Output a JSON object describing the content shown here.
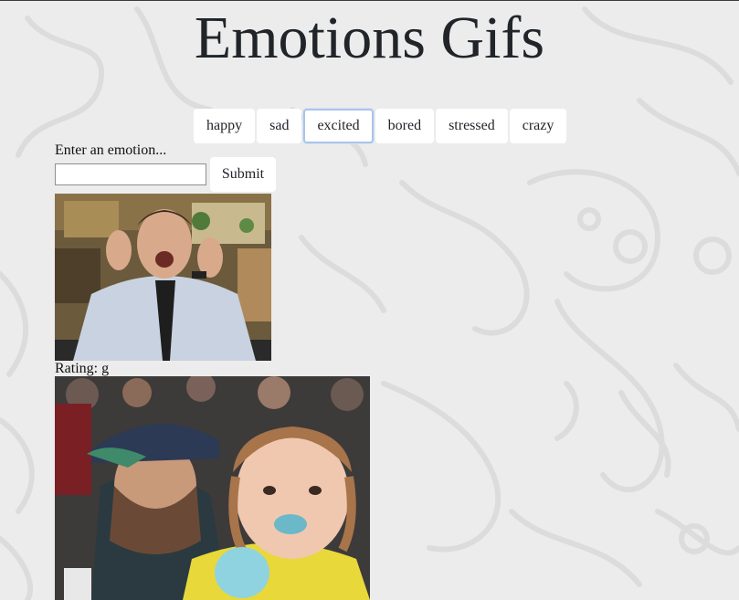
{
  "header": {
    "title": "Emotions Gifs"
  },
  "emotion_buttons": [
    {
      "label": "happy"
    },
    {
      "label": "sad"
    },
    {
      "label": "excited"
    },
    {
      "label": "bored"
    },
    {
      "label": "stressed"
    },
    {
      "label": "crazy"
    }
  ],
  "focused_button": "excited",
  "form": {
    "label": "Enter an emotion...",
    "input_value": "",
    "submit_label": "Submit"
  },
  "results": [
    {
      "rating_label": "Rating: g"
    }
  ],
  "colors": {
    "background": "#ececec",
    "title": "#212529",
    "button_bg": "#ffffff",
    "focus_ring": "#aac4ea"
  }
}
